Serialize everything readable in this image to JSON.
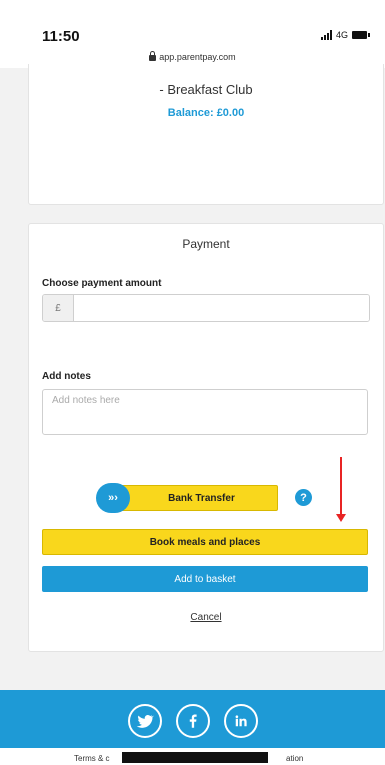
{
  "status_bar": {
    "time": "11:50",
    "network": "4G"
  },
  "browser": {
    "url": "app.parentpay.com"
  },
  "item_card": {
    "name": "- Breakfast Club",
    "balance": "Balance: £0.00"
  },
  "payment": {
    "title": "Payment",
    "amount_label": "Choose payment amount",
    "currency_symbol": "£",
    "amount_value": "",
    "notes_label": "Add notes",
    "notes_placeholder": "Add notes here",
    "bank_transfer_label": "Bank Transfer",
    "bank_transfer_icon_text": "»›",
    "help_icon_text": "?",
    "book_button": "Book meals and places",
    "basket_button": "Add to basket",
    "cancel_link": "Cancel"
  },
  "footer": {
    "social_icons": [
      "twitter-icon",
      "facebook-icon",
      "linkedin-icon"
    ],
    "text_start": "Terms & c",
    "text_end": "ation"
  },
  "colors": {
    "brand_blue": "#1e9ad6",
    "accent_yellow": "#f9d71c",
    "annotation_red": "#e82424"
  }
}
